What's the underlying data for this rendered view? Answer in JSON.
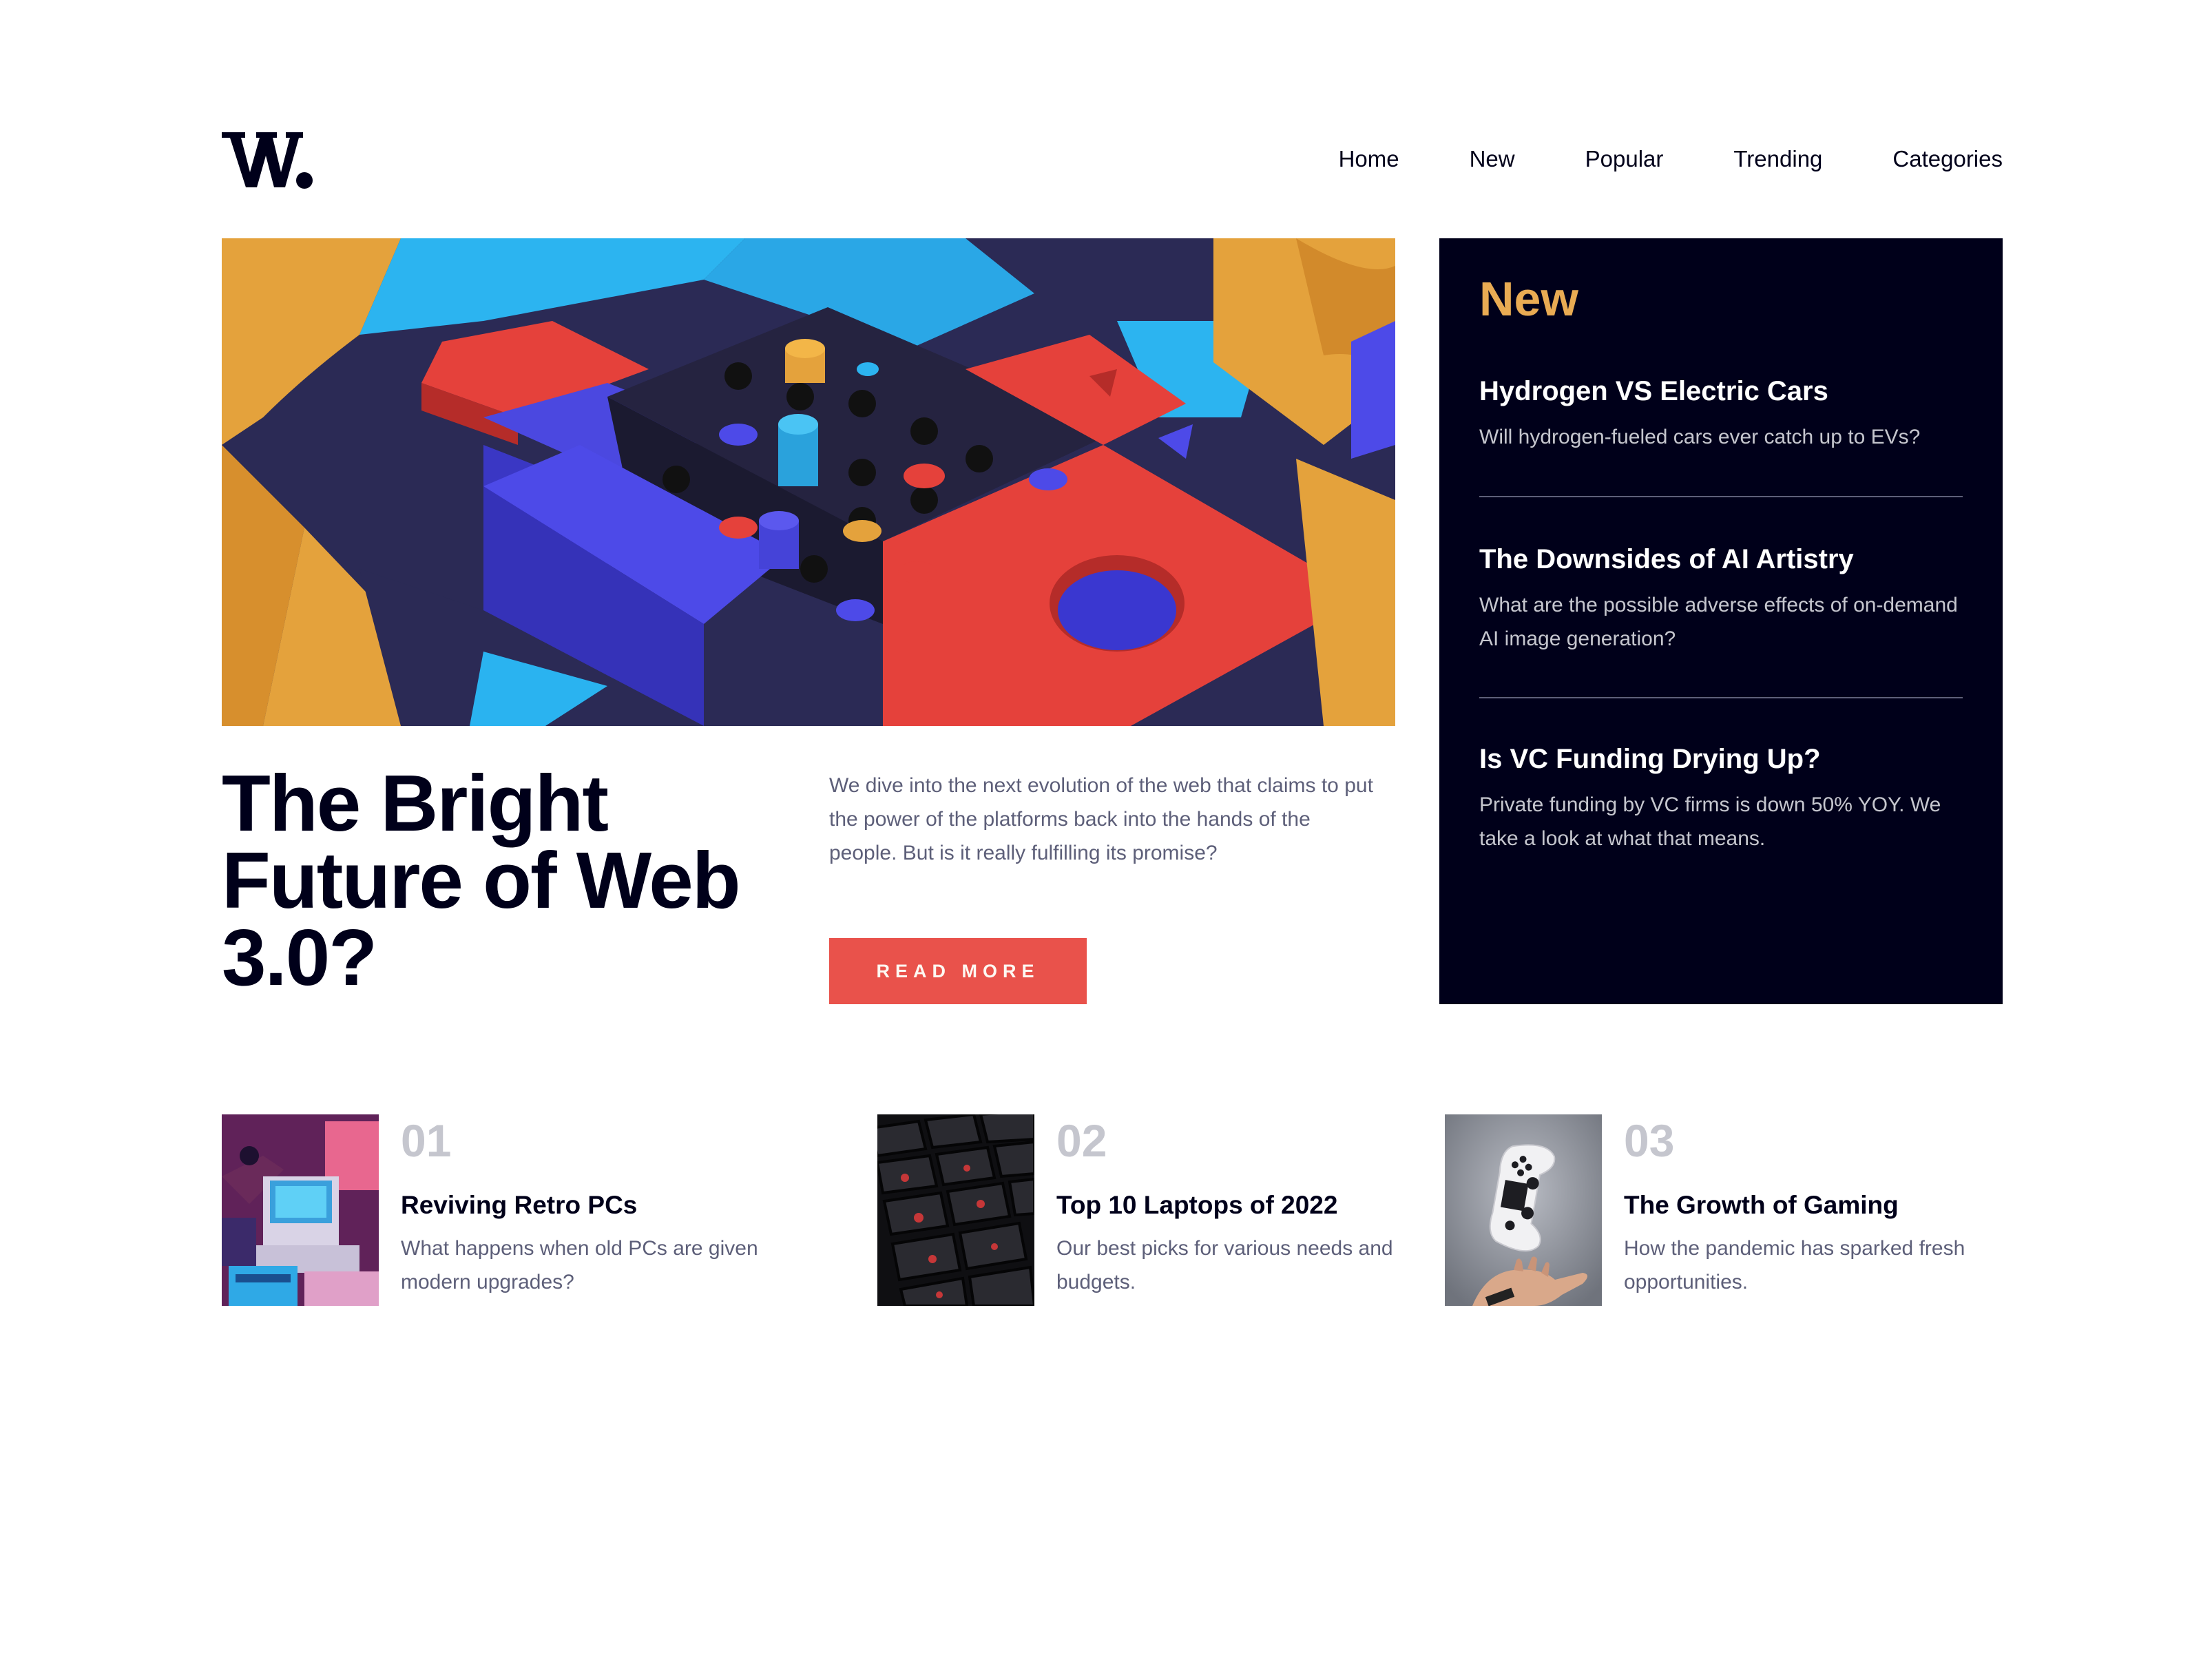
{
  "brand": {
    "logo_text": "W.",
    "logo_icon": "w-logo-icon",
    "colors": {
      "dark": "#00001a",
      "accent": "#e9524b",
      "gold": "#e9ab53",
      "muted": "#5d5f79",
      "light_gray": "#c5c6ce"
    }
  },
  "nav": {
    "items": [
      {
        "label": "Home"
      },
      {
        "label": "New"
      },
      {
        "label": "Popular"
      },
      {
        "label": "Trending"
      },
      {
        "label": "Categories"
      }
    ]
  },
  "hero": {
    "title": "The Bright Future of Web 3.0?",
    "description": "We dive into the next evolution of the web that claims to put the power of the platforms back into the hands of the people. But is it really fulfilling its promise?",
    "cta_label": "READ MORE",
    "image": "colorful-3d-blocks-image"
  },
  "new_panel": {
    "heading": "New",
    "items": [
      {
        "title": "Hydrogen VS Electric Cars",
        "text": "Will hydrogen-fueled cars ever catch up to EVs?"
      },
      {
        "title": "The Downsides of AI Artistry",
        "text": "What are the possible adverse effects of on-demand AI image generation?"
      },
      {
        "title": "Is VC Funding Drying Up?",
        "text": "Private funding by VC firms is down 50% YOY. We take a look at what that means."
      }
    ]
  },
  "cards": [
    {
      "number": "01",
      "title": "Reviving Retro PCs",
      "text": "What happens when old PCs are given modern upgrades?",
      "image": "retro-pc-image"
    },
    {
      "number": "02",
      "title": "Top 10 Laptops of 2022",
      "text": "Our best picks for various needs and budgets.",
      "image": "laptop-keyboard-image"
    },
    {
      "number": "03",
      "title": "The Growth of Gaming",
      "text": "How the pandemic has sparked fresh opportunities.",
      "image": "game-controller-image"
    }
  ]
}
